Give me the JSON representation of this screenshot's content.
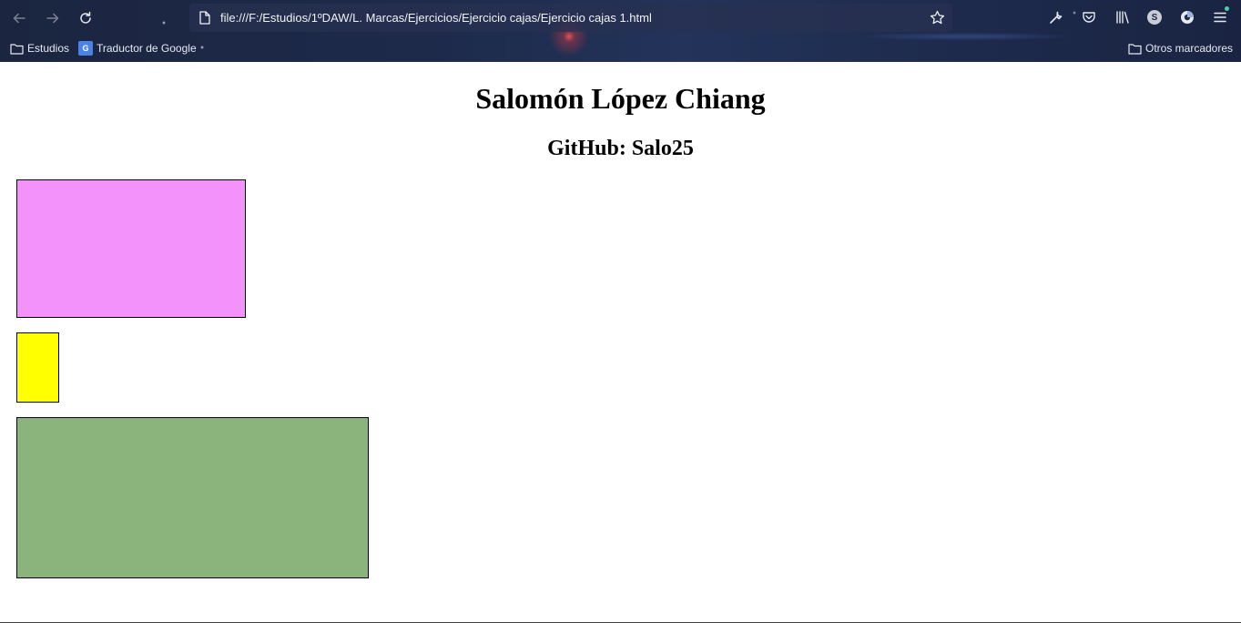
{
  "browser": {
    "url": "file:///F:/Estudios/1ºDAW/L. Marcas/Ejercicios/Ejercicio cajas/Ejercicio cajas 1.html",
    "profile_initial": "S",
    "bookmarks": [
      {
        "label": "Estudios",
        "icon": "folder-icon"
      },
      {
        "label": "Traductor de Google",
        "icon": "google-translate-icon"
      }
    ],
    "other_bookmarks": "Otros marcadores"
  },
  "page": {
    "title": "Salomón López Chiang",
    "subtitle": "GitHub: Salo25",
    "boxes": [
      {
        "color": "#f492fc"
      },
      {
        "color": "#ffff00"
      },
      {
        "color": "#8ab47b"
      }
    ]
  }
}
